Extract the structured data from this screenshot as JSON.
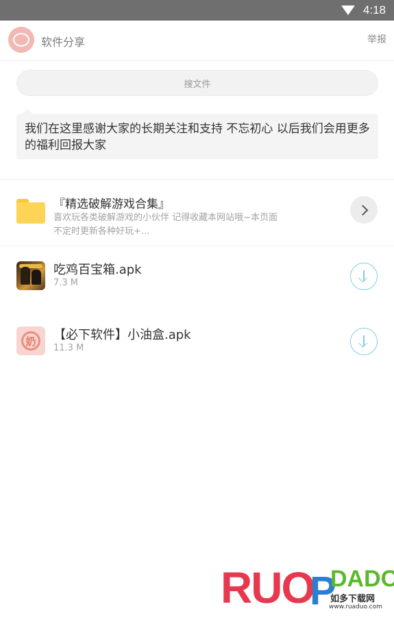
{
  "status_bar": {
    "time": "4:18"
  },
  "header": {
    "title": "软件分享",
    "report_label": "举报"
  },
  "search": {
    "label": "搜文件"
  },
  "message": {
    "text": "我们在这里感谢大家的长期关注和支持 不忘初心 以后我们会用更多的福利回报大家"
  },
  "folder": {
    "title": "『精选破解游戏合集』",
    "description": "喜欢玩各类破解游戏的小伙伴 记得收藏本网站哦~本页面不定时更新各种好玩+..."
  },
  "files": [
    {
      "name": "吃鸡百宝箱.apk",
      "size": "7.3 M",
      "icon": "pubg-game-icon"
    },
    {
      "name": "【必下软件】小油盒.apk",
      "size": "11.3 M",
      "icon": "youhe-app-icon"
    }
  ],
  "watermark": {
    "brand": "RUO",
    "brand2": "P",
    "brand3": "DADO",
    "cn": "如多下载网",
    "url": "www.ruaduo.com"
  },
  "colors": {
    "status_bar": "#6f6f6f",
    "accent_download": "#7fd0dc",
    "folder": "#fdd456"
  }
}
